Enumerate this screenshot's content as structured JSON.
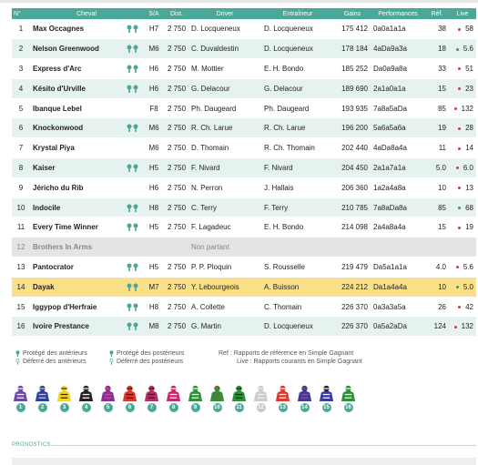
{
  "colors": {
    "header_bg": "#4aa79a",
    "row_alt": "#e6f2f0",
    "highlight": "#fbe08a",
    "non_partant": "#e4e4e4",
    "live_red": "#d93a30",
    "live_green": "#32a24a",
    "shoe_green": "#4aa79a"
  },
  "columns": [
    "N°",
    "Cheval",
    "S/A",
    "Dist.",
    "Driver",
    "Entraîneur",
    "Gains",
    "Performances",
    "Réf.",
    "Live"
  ],
  "runners": [
    {
      "num": "1",
      "name": "Max Occagnes",
      "shoes": "post",
      "sa": "H7",
      "dist": "2 750",
      "driver": "D. Locqueneux",
      "trainer": "D. Locqueneux",
      "gains": "175 412",
      "perf": "0a0a1a1a",
      "ref": "38",
      "live": "58",
      "trend": "red",
      "style": "odd"
    },
    {
      "num": "2",
      "name": "Nelson Greenwood",
      "shoes": "both",
      "sa": "M6",
      "dist": "2 750",
      "driver": "C. Duvaldestin",
      "trainer": "D. Locqueneux",
      "gains": "178 184",
      "perf": "4aDa9a3a",
      "ref": "18",
      "live": "5.6",
      "trend": "green",
      "style": "even"
    },
    {
      "num": "3",
      "name": "Express d'Arc",
      "shoes": "both",
      "sa": "H6",
      "dist": "2 750",
      "driver": "M. Mottier",
      "trainer": "E. H. Bondo",
      "gains": "185 252",
      "perf": "Da0a9a8a",
      "ref": "33",
      "live": "51",
      "trend": "red",
      "style": "odd"
    },
    {
      "num": "4",
      "name": "Késito d'Urville",
      "shoes": "both",
      "sa": "H6",
      "dist": "2 750",
      "driver": "G. Delacour",
      "trainer": "G. Delacour",
      "gains": "189 690",
      "perf": "2a1a0a1a",
      "ref": "15",
      "live": "23",
      "trend": "red",
      "style": "even"
    },
    {
      "num": "5",
      "name": "Ibanque Lebel",
      "shoes": "none",
      "sa": "F8",
      "dist": "2 750",
      "driver": "Ph. Daugeard",
      "trainer": "Ph. Daugeard",
      "gains": "193 935",
      "perf": "7a8a5aDa",
      "ref": "85",
      "live": "132",
      "trend": "red",
      "style": "odd"
    },
    {
      "num": "6",
      "name": "Knockonwood",
      "shoes": "post",
      "sa": "M6",
      "dist": "2 750",
      "driver": "R. Ch. Larue",
      "trainer": "R. Ch. Larue",
      "gains": "196 200",
      "perf": "5a6a5a6a",
      "ref": "19",
      "live": "28",
      "trend": "red",
      "style": "even"
    },
    {
      "num": "7",
      "name": "Krystal Piya",
      "shoes": "none",
      "sa": "M6",
      "dist": "2 750",
      "driver": "D. Thomain",
      "trainer": "R. Ch. Thomain",
      "gains": "202 440",
      "perf": "4aDa8a4a",
      "ref": "11",
      "live": "14",
      "trend": "red",
      "style": "odd"
    },
    {
      "num": "8",
      "name": "Kaiser",
      "shoes": "both",
      "sa": "H5",
      "dist": "2 750",
      "driver": "F. Nivard",
      "trainer": "F. Nivard",
      "gains": "204 450",
      "perf": "2a1a7a1a",
      "ref": "5.0",
      "live": "6.0",
      "trend": "red",
      "style": "even"
    },
    {
      "num": "9",
      "name": "Jéricho du Rib",
      "shoes": "none",
      "sa": "H6",
      "dist": "2 750",
      "driver": "N. Perron",
      "trainer": "J. Hallais",
      "gains": "206 360",
      "perf": "1a2a4a8a",
      "ref": "10",
      "live": "13",
      "trend": "red",
      "style": "odd"
    },
    {
      "num": "10",
      "name": "Indocile",
      "shoes": "both",
      "sa": "H8",
      "dist": "2 750",
      "driver": "C. Terry",
      "trainer": "F. Terry",
      "gains": "210 785",
      "perf": "7a8aDa8a",
      "ref": "85",
      "live": "68",
      "trend": "green",
      "style": "even"
    },
    {
      "num": "11",
      "name": "Every Time Winner",
      "shoes": "both",
      "sa": "H5",
      "dist": "2 750",
      "driver": "F. Lagadeuc",
      "trainer": "E. H. Bondo",
      "gains": "214 098",
      "perf": "2a4a8a4a",
      "ref": "15",
      "live": "19",
      "trend": "red",
      "style": "odd"
    },
    {
      "num": "12",
      "name": "Brothers In Arms",
      "shoes": "none",
      "sa": "",
      "dist": "",
      "driver": "Non partant",
      "trainer": "",
      "gains": "",
      "perf": "",
      "ref": "",
      "live": "",
      "trend": "none",
      "style": "nonpartant"
    },
    {
      "num": "13",
      "name": "Pantocrator",
      "shoes": "ant",
      "sa": "H5",
      "dist": "2 750",
      "driver": "P. P. Ploquin",
      "trainer": "S. Rousselle",
      "gains": "219 479",
      "perf": "Da5a1a1a",
      "ref": "4.0",
      "live": "5.6",
      "trend": "red",
      "style": "odd"
    },
    {
      "num": "14",
      "name": "Dayak",
      "shoes": "both",
      "sa": "M7",
      "dist": "2 750",
      "driver": "Y. Lebourgeois",
      "trainer": "A. Buisson",
      "gains": "224 212",
      "perf": "Da1a4a4a",
      "ref": "10",
      "live": "5.0",
      "trend": "green",
      "style": "highlight"
    },
    {
      "num": "15",
      "name": "Iggypop d'Herfraie",
      "shoes": "both",
      "sa": "H8",
      "dist": "2 750",
      "driver": "A. Collette",
      "trainer": "C. Thomain",
      "gains": "226 370",
      "perf": "0a3a3a5a",
      "ref": "26",
      "live": "42",
      "trend": "red",
      "style": "odd"
    },
    {
      "num": "16",
      "name": "Ivoire Prestance",
      "shoes": "post",
      "sa": "M8",
      "dist": "2 750",
      "driver": "G. Martin",
      "trainer": "D. Locqueneux",
      "gains": "226 370",
      "perf": "0a5a2aDa",
      "ref": "124",
      "live": "132",
      "trend": "red",
      "style": "even"
    }
  ],
  "legend": {
    "protege_ant": "Protégé des antérieurs",
    "deferre_ant": "Déferré des antérieurs",
    "protege_post": "Protégé des postérieurs",
    "deferre_post": "Déferré des postérieurs",
    "ref": "Ref : Rapports de référence en Simple Gagnant",
    "live": "Live : Rapports courants en Simple Gagnant"
  },
  "silks": [
    {
      "num": "1",
      "body": "#6b4aa0",
      "trim": "#ffffff",
      "cap": "#6b4aa0"
    },
    {
      "num": "2",
      "body": "#2b3fa8",
      "trim": "#f2d22e",
      "cap": "#2b3fa8"
    },
    {
      "num": "3",
      "body": "#f2d22e",
      "trim": "#222222",
      "cap": "#f2d22e"
    },
    {
      "num": "4",
      "body": "#222222",
      "trim": "#ffffff",
      "cap": "#222222"
    },
    {
      "num": "5",
      "body": "#8a2f8f",
      "trim": "#e0457a",
      "cap": "#8a2f8f"
    },
    {
      "num": "6",
      "body": "#d93a30",
      "trim": "#222222",
      "cap": "#d93a30"
    },
    {
      "num": "7",
      "body": "#b0306a",
      "trim": "#222222",
      "cap": "#b0306a"
    },
    {
      "num": "8",
      "body": "#c9286a",
      "trim": "#ffffff",
      "cap": "#c9286a"
    },
    {
      "num": "9",
      "body": "#2f8f3a",
      "trim": "#ffffff",
      "cap": "#2f8f3a"
    },
    {
      "num": "10",
      "body": "#2f8f3a",
      "trim": "#d93a30",
      "cap": "#2f8f3a"
    },
    {
      "num": "11",
      "body": "#2f8f3a",
      "trim": "#222222",
      "cap": "#2f8f3a"
    },
    {
      "num": "12",
      "body": "#cccccc",
      "trim": "#eeeeee",
      "cap": "#cccccc",
      "np": true
    },
    {
      "num": "13",
      "body": "#d93a30",
      "trim": "#ffffff",
      "cap": "#d93a30"
    },
    {
      "num": "14",
      "body": "#3a3aa0",
      "trim": "#d93a30",
      "cap": "#3a3aa0"
    },
    {
      "num": "15",
      "body": "#3a3aa0",
      "trim": "#ffffff",
      "cap": "#222222"
    },
    {
      "num": "16",
      "body": "#2f8f3a",
      "trim": "#ffffff",
      "cap": "#2f8f3a"
    }
  ],
  "pronostics": {
    "title": "PRONOSTICS"
  }
}
